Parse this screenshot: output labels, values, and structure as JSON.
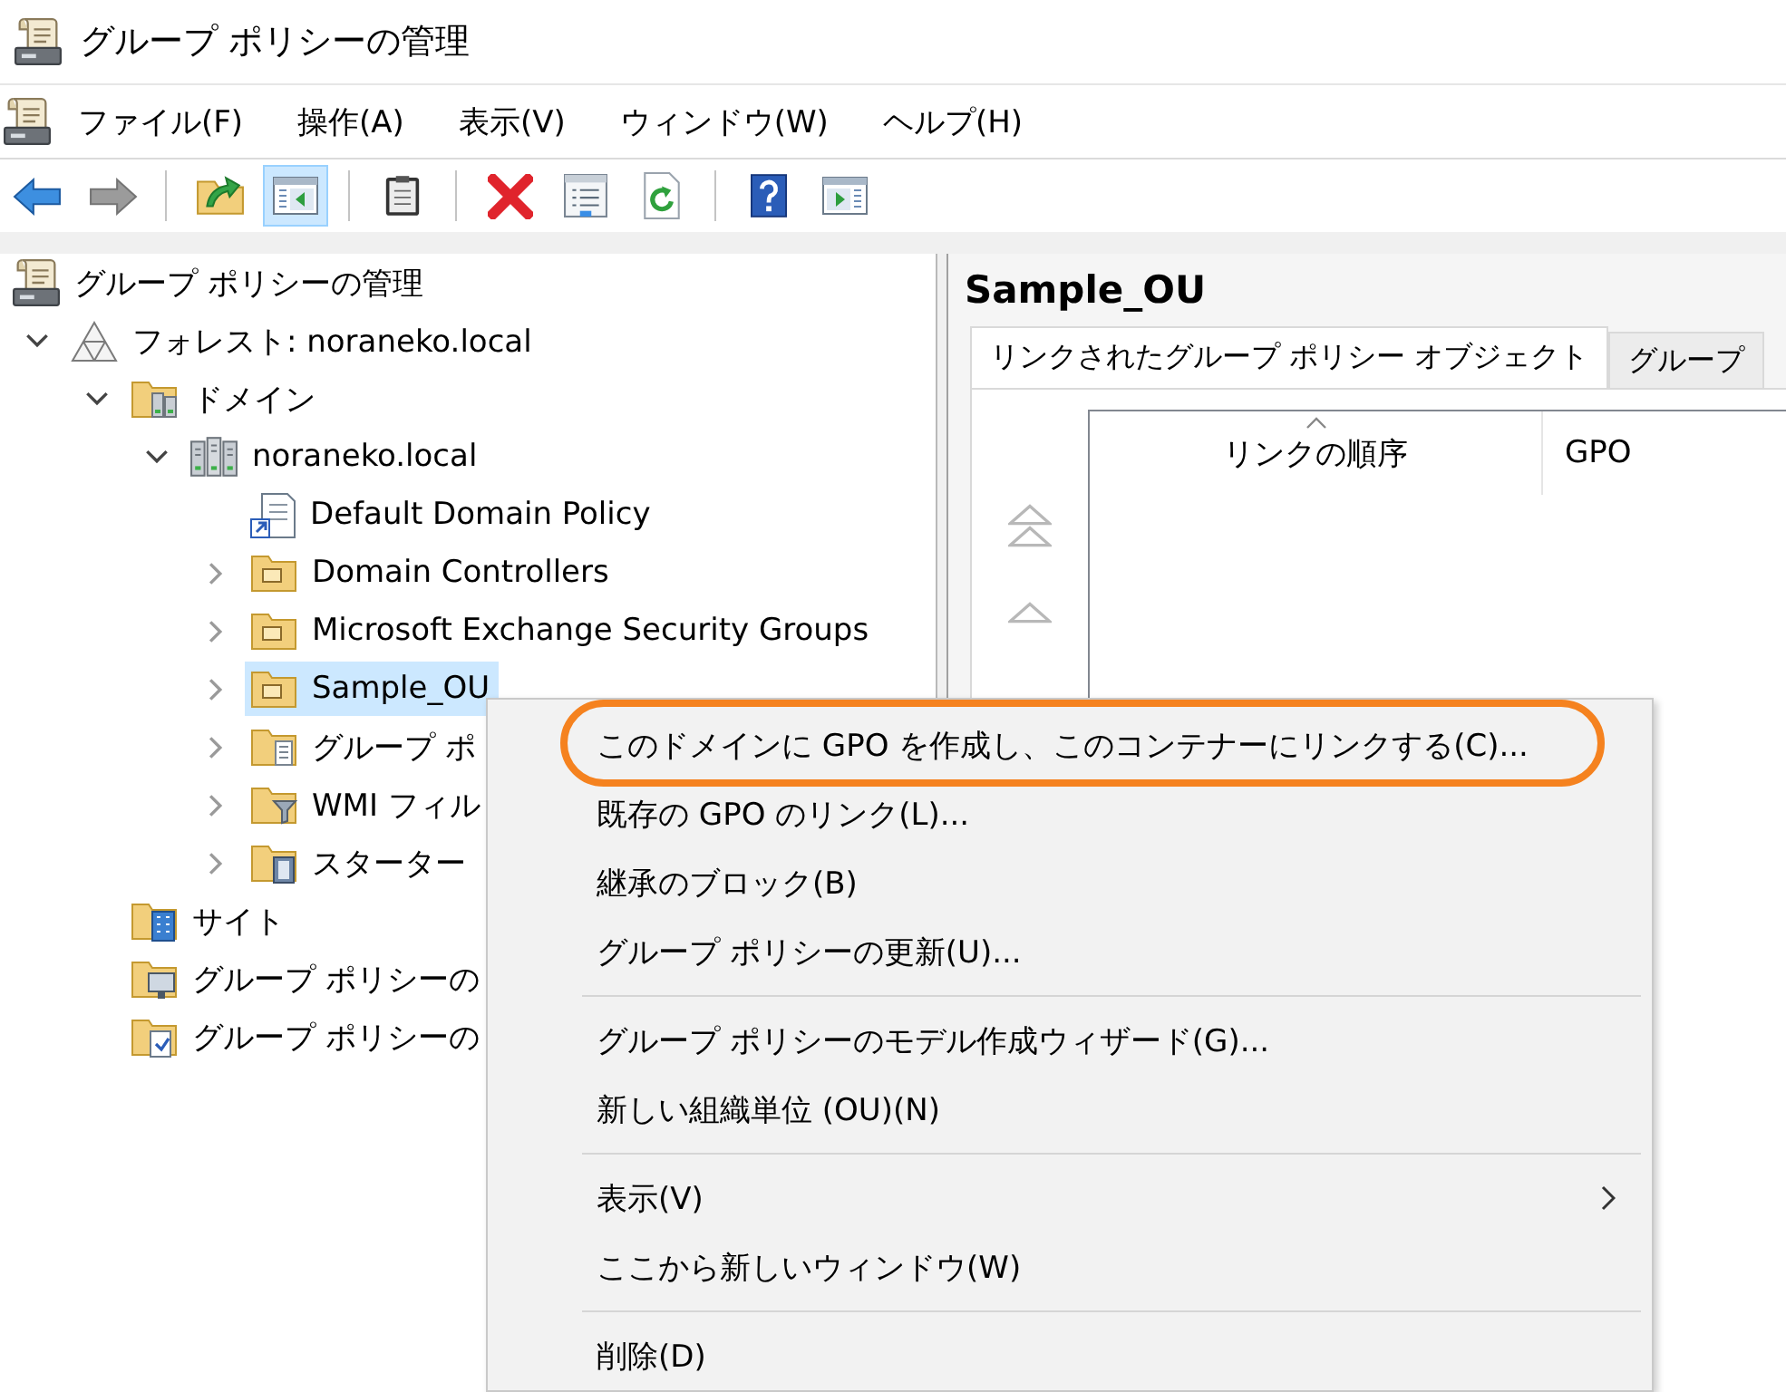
{
  "window": {
    "title": "グループ ポリシーの管理"
  },
  "menu_bar": [
    "ファイル(F)",
    "操作(A)",
    "表示(V)",
    "ウィンドウ(W)",
    "ヘルプ(H)"
  ],
  "toolbar": [
    {
      "kind": "back",
      "pressed": false,
      "disabled": false
    },
    {
      "kind": "forward",
      "pressed": false,
      "disabled": true
    },
    {
      "kind": "separator"
    },
    {
      "kind": "up",
      "pressed": false,
      "disabled": false
    },
    {
      "kind": "console-tree",
      "pressed": true,
      "disabled": false
    },
    {
      "kind": "separator"
    },
    {
      "kind": "export",
      "pressed": false,
      "disabled": false
    },
    {
      "kind": "separator"
    },
    {
      "kind": "delete",
      "pressed": false,
      "disabled": false
    },
    {
      "kind": "properties",
      "pressed": false,
      "disabled": false
    },
    {
      "kind": "refresh",
      "pressed": false,
      "disabled": false
    },
    {
      "kind": "separator"
    },
    {
      "kind": "help",
      "pressed": false,
      "disabled": false
    },
    {
      "kind": "action-pane",
      "pressed": false,
      "disabled": false
    }
  ],
  "tree": [
    {
      "label": "グループ ポリシーの管理",
      "kind": "console",
      "selected": false,
      "children": [
        {
          "label": "フォレスト: noraneko.local",
          "kind": "forest",
          "expanded": true,
          "selected": false,
          "children": [
            {
              "label": "ドメイン",
              "kind": "domains",
              "expanded": true,
              "selected": false,
              "children": [
                {
                  "label": "noraneko.local",
                  "kind": "domain",
                  "expanded": true,
                  "selected": false,
                  "children": [
                    {
                      "label": "Default Domain Policy",
                      "kind": "gpo-link",
                      "selected": false
                    },
                    {
                      "label": "Domain Controllers",
                      "kind": "ou",
                      "expanded": false,
                      "selected": false
                    },
                    {
                      "label": "Microsoft Exchange Security Groups",
                      "kind": "ou",
                      "expanded": false,
                      "selected": false
                    },
                    {
                      "label": "Sample_OU",
                      "kind": "ou",
                      "expanded": false,
                      "selected": true
                    },
                    {
                      "label": "グループ ポ",
                      "kind": "gpo-folder",
                      "expanded": false,
                      "selected": false
                    },
                    {
                      "label": "WMI フィル",
                      "kind": "wmi-folder",
                      "expanded": false,
                      "selected": false
                    },
                    {
                      "label": "スターター",
                      "kind": "starter-folder",
                      "expanded": false,
                      "selected": false
                    }
                  ]
                }
              ]
            },
            {
              "label": "サイト",
              "kind": "sites",
              "selected": false
            },
            {
              "label": "グループ ポリシーの",
              "kind": "modeling",
              "selected": false
            },
            {
              "label": "グループ ポリシーの",
              "kind": "results",
              "selected": false
            }
          ]
        }
      ]
    }
  ],
  "details": {
    "title": "Sample_OU",
    "tabs": [
      {
        "label": "リンクされたグループ ポリシー オブジェクト",
        "selected": true
      },
      {
        "label": "グループ",
        "selected": false
      }
    ],
    "order_buttons": [
      {
        "kind": "move-top",
        "disabled": true
      },
      {
        "kind": "move-up",
        "disabled": true
      }
    ],
    "columns": [
      {
        "label": "リンクの順序",
        "sorted": true
      },
      {
        "label": "GPO",
        "sorted": false
      }
    ]
  },
  "context_menu": {
    "items": [
      {
        "kind": "command",
        "label": "このドメインに GPO を作成し、このコンテナーにリンクする(C)...",
        "circled": true
      },
      {
        "kind": "command",
        "label": "既存の GPO のリンク(L)...",
        "circled": false
      },
      {
        "kind": "command",
        "label": "継承のブロック(B)",
        "circled": false
      },
      {
        "kind": "command",
        "label": "グループ ポリシーの更新(U)...",
        "circled": false
      },
      {
        "kind": "separator"
      },
      {
        "kind": "command",
        "label": "グループ ポリシーのモデル作成ウィザード(G)...",
        "circled": false
      },
      {
        "kind": "command",
        "label": "新しい組織単位 (OU)(N)",
        "circled": false
      },
      {
        "kind": "separator"
      },
      {
        "kind": "submenu",
        "label": "表示(V)",
        "circled": false
      },
      {
        "kind": "command",
        "label": "ここから新しいウィンドウ(W)",
        "circled": false
      },
      {
        "kind": "separator"
      },
      {
        "kind": "command",
        "label": "削除(D)",
        "circled": false
      }
    ]
  }
}
